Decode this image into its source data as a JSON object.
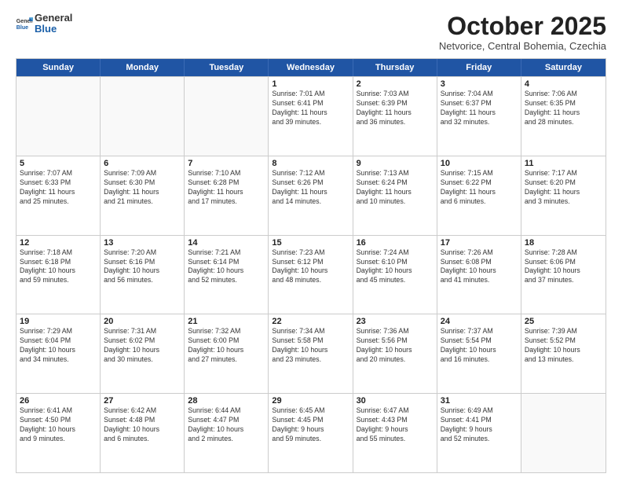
{
  "header": {
    "logo_general": "General",
    "logo_blue": "Blue",
    "month_title": "October 2025",
    "location": "Netvorice, Central Bohemia, Czechia"
  },
  "weekdays": [
    "Sunday",
    "Monday",
    "Tuesday",
    "Wednesday",
    "Thursday",
    "Friday",
    "Saturday"
  ],
  "rows": [
    [
      {
        "day": "",
        "info": ""
      },
      {
        "day": "",
        "info": ""
      },
      {
        "day": "",
        "info": ""
      },
      {
        "day": "1",
        "info": "Sunrise: 7:01 AM\nSunset: 6:41 PM\nDaylight: 11 hours\nand 39 minutes."
      },
      {
        "day": "2",
        "info": "Sunrise: 7:03 AM\nSunset: 6:39 PM\nDaylight: 11 hours\nand 36 minutes."
      },
      {
        "day": "3",
        "info": "Sunrise: 7:04 AM\nSunset: 6:37 PM\nDaylight: 11 hours\nand 32 minutes."
      },
      {
        "day": "4",
        "info": "Sunrise: 7:06 AM\nSunset: 6:35 PM\nDaylight: 11 hours\nand 28 minutes."
      }
    ],
    [
      {
        "day": "5",
        "info": "Sunrise: 7:07 AM\nSunset: 6:33 PM\nDaylight: 11 hours\nand 25 minutes."
      },
      {
        "day": "6",
        "info": "Sunrise: 7:09 AM\nSunset: 6:30 PM\nDaylight: 11 hours\nand 21 minutes."
      },
      {
        "day": "7",
        "info": "Sunrise: 7:10 AM\nSunset: 6:28 PM\nDaylight: 11 hours\nand 17 minutes."
      },
      {
        "day": "8",
        "info": "Sunrise: 7:12 AM\nSunset: 6:26 PM\nDaylight: 11 hours\nand 14 minutes."
      },
      {
        "day": "9",
        "info": "Sunrise: 7:13 AM\nSunset: 6:24 PM\nDaylight: 11 hours\nand 10 minutes."
      },
      {
        "day": "10",
        "info": "Sunrise: 7:15 AM\nSunset: 6:22 PM\nDaylight: 11 hours\nand 6 minutes."
      },
      {
        "day": "11",
        "info": "Sunrise: 7:17 AM\nSunset: 6:20 PM\nDaylight: 11 hours\nand 3 minutes."
      }
    ],
    [
      {
        "day": "12",
        "info": "Sunrise: 7:18 AM\nSunset: 6:18 PM\nDaylight: 10 hours\nand 59 minutes."
      },
      {
        "day": "13",
        "info": "Sunrise: 7:20 AM\nSunset: 6:16 PM\nDaylight: 10 hours\nand 56 minutes."
      },
      {
        "day": "14",
        "info": "Sunrise: 7:21 AM\nSunset: 6:14 PM\nDaylight: 10 hours\nand 52 minutes."
      },
      {
        "day": "15",
        "info": "Sunrise: 7:23 AM\nSunset: 6:12 PM\nDaylight: 10 hours\nand 48 minutes."
      },
      {
        "day": "16",
        "info": "Sunrise: 7:24 AM\nSunset: 6:10 PM\nDaylight: 10 hours\nand 45 minutes."
      },
      {
        "day": "17",
        "info": "Sunrise: 7:26 AM\nSunset: 6:08 PM\nDaylight: 10 hours\nand 41 minutes."
      },
      {
        "day": "18",
        "info": "Sunrise: 7:28 AM\nSunset: 6:06 PM\nDaylight: 10 hours\nand 37 minutes."
      }
    ],
    [
      {
        "day": "19",
        "info": "Sunrise: 7:29 AM\nSunset: 6:04 PM\nDaylight: 10 hours\nand 34 minutes."
      },
      {
        "day": "20",
        "info": "Sunrise: 7:31 AM\nSunset: 6:02 PM\nDaylight: 10 hours\nand 30 minutes."
      },
      {
        "day": "21",
        "info": "Sunrise: 7:32 AM\nSunset: 6:00 PM\nDaylight: 10 hours\nand 27 minutes."
      },
      {
        "day": "22",
        "info": "Sunrise: 7:34 AM\nSunset: 5:58 PM\nDaylight: 10 hours\nand 23 minutes."
      },
      {
        "day": "23",
        "info": "Sunrise: 7:36 AM\nSunset: 5:56 PM\nDaylight: 10 hours\nand 20 minutes."
      },
      {
        "day": "24",
        "info": "Sunrise: 7:37 AM\nSunset: 5:54 PM\nDaylight: 10 hours\nand 16 minutes."
      },
      {
        "day": "25",
        "info": "Sunrise: 7:39 AM\nSunset: 5:52 PM\nDaylight: 10 hours\nand 13 minutes."
      }
    ],
    [
      {
        "day": "26",
        "info": "Sunrise: 6:41 AM\nSunset: 4:50 PM\nDaylight: 10 hours\nand 9 minutes."
      },
      {
        "day": "27",
        "info": "Sunrise: 6:42 AM\nSunset: 4:48 PM\nDaylight: 10 hours\nand 6 minutes."
      },
      {
        "day": "28",
        "info": "Sunrise: 6:44 AM\nSunset: 4:47 PM\nDaylight: 10 hours\nand 2 minutes."
      },
      {
        "day": "29",
        "info": "Sunrise: 6:45 AM\nSunset: 4:45 PM\nDaylight: 9 hours\nand 59 minutes."
      },
      {
        "day": "30",
        "info": "Sunrise: 6:47 AM\nSunset: 4:43 PM\nDaylight: 9 hours\nand 55 minutes."
      },
      {
        "day": "31",
        "info": "Sunrise: 6:49 AM\nSunset: 4:41 PM\nDaylight: 9 hours\nand 52 minutes."
      },
      {
        "day": "",
        "info": ""
      }
    ]
  ]
}
